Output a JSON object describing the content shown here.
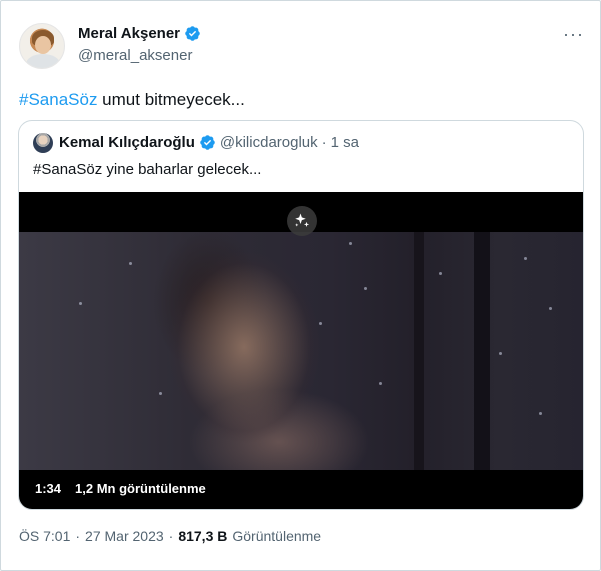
{
  "author": {
    "name": "Meral Akşener",
    "handle": "@meral_aksener"
  },
  "more_label": "···",
  "tweet": {
    "hashtag": "#SanaSöz",
    "text": " umut bitmeyecek..."
  },
  "quote": {
    "name": "Kemal Kılıçdaroğlu",
    "handle": "@kilicdarogluk",
    "dot": "·",
    "time": "1 sa",
    "text": "#SanaSöz yine baharlar gelecek..."
  },
  "video": {
    "duration": "1:34",
    "views": "1,2 Mn görüntülenme"
  },
  "footer": {
    "time": "ÖS 7:01",
    "dot1": "·",
    "date": "27 Mar 2023",
    "dot2": "·",
    "view_count": "817,3 B",
    "view_label": "Görüntülenme"
  },
  "colors": {
    "accent": "#1d9bf0",
    "text": "#0f1419",
    "muted": "#536471",
    "border": "#cfd9de"
  },
  "icons": {
    "verified": "verified-badge-icon",
    "more": "more-horizontal-icon",
    "sparkle": "sparkle-icon"
  }
}
